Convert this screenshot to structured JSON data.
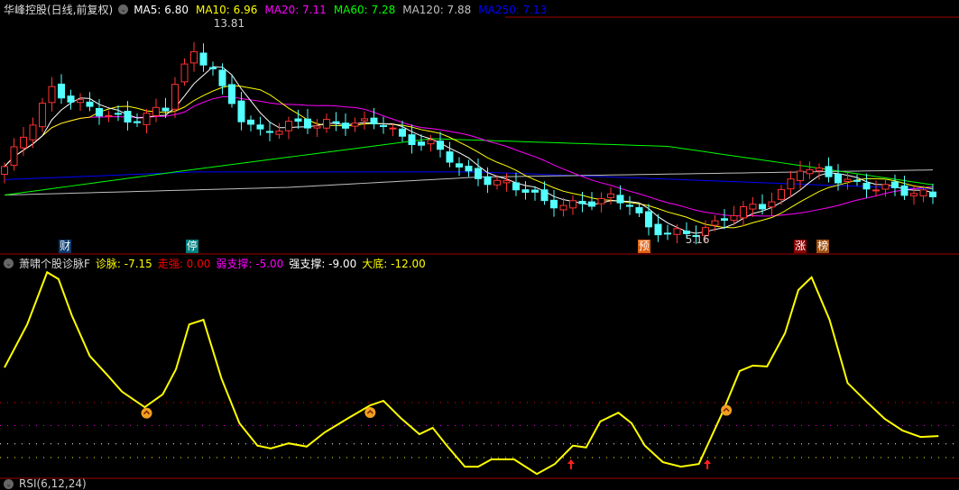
{
  "header": {
    "title": "华峰控股(日线,前复权)",
    "ma": [
      {
        "label": "MA5: 6.80",
        "color": "#ffffff"
      },
      {
        "label": "MA10: 6.96",
        "color": "#ffff00"
      },
      {
        "label": "MA20: 7.11",
        "color": "#ff00ff"
      },
      {
        "label": "MA60: 7.28",
        "color": "#00ff00"
      },
      {
        "label": "MA120: 7.88",
        "color": "#c0c0c0"
      },
      {
        "label": "MA250: 7.13",
        "color": "#0000ff"
      }
    ]
  },
  "price": {
    "high_label": "13.81",
    "low_label": "5.16"
  },
  "badges": [
    {
      "text": "财",
      "bg": "#0a3a6e",
      "i": 6.4
    },
    {
      "text": "停",
      "bg": "#008080",
      "i": 19.8
    },
    {
      "text": "预",
      "bg": "#e06010",
      "i": 67.5
    },
    {
      "text": "涨",
      "bg": "#8b0000",
      "i": 84
    },
    {
      "text": "榜",
      "bg": "#a05010",
      "i": 86.4
    }
  ],
  "indicator": {
    "name": "萧啸个股诊脉F",
    "items": [
      {
        "label": "诊脉: -7.15",
        "color": "#ffff00"
      },
      {
        "label": "走强: 0.00",
        "color": "#ff0000"
      },
      {
        "label": "弱支撑: -5.00",
        "color": "#ff00ff"
      },
      {
        "label": "强支撑: -9.00",
        "color": "#ffffff"
      },
      {
        "label": "大底: -12.00",
        "color": "#ffff00"
      }
    ]
  },
  "bottom": {
    "label": "RSI(6,12,24)"
  },
  "chart_data": {
    "type": "candlestick",
    "candle_count": 99,
    "close_keypoints": [
      [
        0,
        8.01
      ],
      [
        5,
        10.99
      ],
      [
        9,
        10.29
      ],
      [
        13,
        9.77
      ],
      [
        17,
        10.29
      ],
      [
        18,
        11.35
      ],
      [
        20,
        12.4
      ],
      [
        22,
        11.88
      ],
      [
        23,
        10.99
      ],
      [
        25,
        9.94
      ],
      [
        27,
        9.31
      ],
      [
        30,
        9.66
      ],
      [
        38,
        9.7
      ],
      [
        40,
        9.77
      ],
      [
        42,
        9.06
      ],
      [
        45,
        8.89
      ],
      [
        47,
        8.36
      ],
      [
        49,
        7.66
      ],
      [
        55,
        7.13
      ],
      [
        57,
        6.6
      ],
      [
        60,
        6.5
      ],
      [
        64,
        6.78
      ],
      [
        66,
        6.6
      ],
      [
        68,
        5.55
      ],
      [
        72,
        5.37
      ],
      [
        75,
        5.72
      ],
      [
        77,
        6.25
      ],
      [
        80,
        6.5
      ],
      [
        82,
        6.95
      ],
      [
        84,
        8.01
      ],
      [
        87,
        7.66
      ],
      [
        90,
        7.31
      ],
      [
        95,
        7.06
      ],
      [
        98,
        6.85
      ]
    ],
    "ma60_keypoints": [
      [
        0,
        6.9
      ],
      [
        20,
        7.9
      ],
      [
        45,
        9.1
      ],
      [
        70,
        8.8
      ],
      [
        85,
        8.0
      ],
      [
        98,
        7.3
      ]
    ],
    "ma120_keypoints": [
      [
        0,
        6.9
      ],
      [
        30,
        7.2
      ],
      [
        50,
        7.6
      ],
      [
        98,
        7.88
      ]
    ],
    "ma250_keypoints": [
      [
        0,
        7.5
      ],
      [
        20,
        7.8
      ],
      [
        50,
        7.8
      ],
      [
        98,
        7.13
      ]
    ],
    "indicator_keypoints": [
      [
        0,
        7.68
      ],
      [
        2.4,
        17.1
      ],
      [
        4.5,
        28.5
      ],
      [
        5.7,
        27
      ],
      [
        7.1,
        19.1
      ],
      [
        9,
        10.2
      ],
      [
        11,
        5.7
      ],
      [
        12.4,
        2.4
      ],
      [
        14.8,
        -1
      ],
      [
        16.7,
        1.8
      ],
      [
        18.1,
        7.3
      ],
      [
        19.5,
        17.1
      ],
      [
        21,
        18.1
      ],
      [
        22.9,
        5.3
      ],
      [
        24.8,
        -4.5
      ],
      [
        26.7,
        -9.4
      ],
      [
        28.1,
        -10
      ],
      [
        30,
        -8.9
      ],
      [
        31.9,
        -9.6
      ],
      [
        33.8,
        -6.5
      ],
      [
        36.2,
        -3.5
      ],
      [
        38.6,
        -0.6
      ],
      [
        40,
        0.4
      ],
      [
        41.9,
        -3.5
      ],
      [
        43.8,
        -6.9
      ],
      [
        45.2,
        -5.5
      ],
      [
        46.7,
        -9.4
      ],
      [
        48.6,
        -14
      ],
      [
        50,
        -14
      ],
      [
        51.4,
        -12.4
      ],
      [
        53.8,
        -12.4
      ],
      [
        56.2,
        -15.6
      ],
      [
        58.1,
        -13.4
      ],
      [
        60,
        -9.4
      ],
      [
        61.4,
        -9.8
      ],
      [
        62.9,
        -4.1
      ],
      [
        64.8,
        -2.2
      ],
      [
        66.2,
        -4.5
      ],
      [
        67.6,
        -9.4
      ],
      [
        69.5,
        -13
      ],
      [
        71.4,
        -14
      ],
      [
        73.3,
        -13.4
      ],
      [
        75.7,
        -2.6
      ],
      [
        77.6,
        6.9
      ],
      [
        79,
        8.1
      ],
      [
        80.5,
        7.9
      ],
      [
        82.4,
        15.2
      ],
      [
        83.8,
        24.6
      ],
      [
        85.2,
        27.4
      ],
      [
        87.1,
        18.1
      ],
      [
        89,
        4.3
      ],
      [
        90.9,
        0.4
      ],
      [
        92.9,
        -3.5
      ],
      [
        94.8,
        -6.1
      ],
      [
        96.7,
        -7.5
      ],
      [
        98.6,
        -7.3
      ]
    ],
    "buy_signals": [
      15,
      38.6,
      76.2
    ],
    "up_arrows": [
      59.8,
      74.2
    ],
    "levels": [
      {
        "value": 0,
        "color": "#ff0000"
      },
      {
        "value": -5,
        "color": "#ff00ff"
      },
      {
        "value": -9,
        "color": "#ffffff"
      },
      {
        "value": -12,
        "color": "#ffff00"
      }
    ]
  }
}
